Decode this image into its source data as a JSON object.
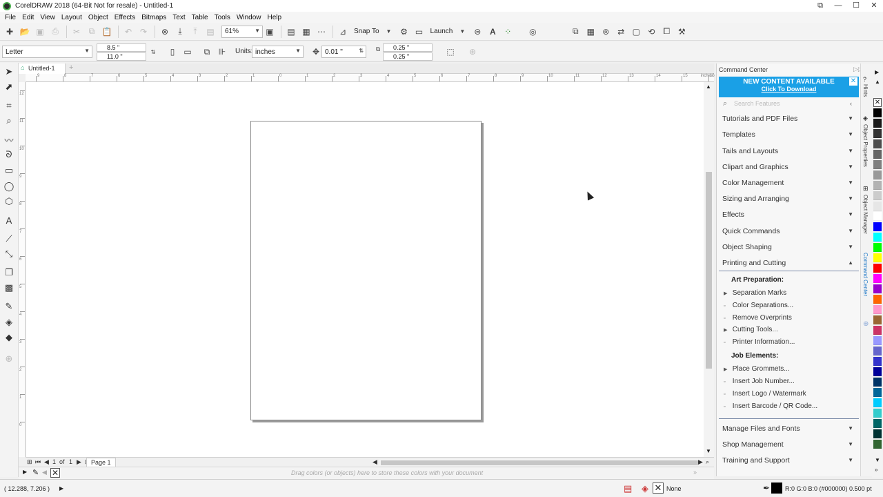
{
  "window": {
    "title": "CorelDRAW 2018 (64-Bit Not for resale) - Untitled-1",
    "controls": [
      "⧉",
      "—",
      "☐",
      "✕"
    ]
  },
  "menu": [
    "File",
    "Edit",
    "View",
    "Layout",
    "Object",
    "Effects",
    "Bitmaps",
    "Text",
    "Table",
    "Tools",
    "Window",
    "Help"
  ],
  "standard_toolbar": {
    "zoom": "61%",
    "snap_to": "Snap To",
    "launch": "Launch"
  },
  "property_bar": {
    "page_size": "Letter",
    "width": "8.5 \"",
    "height": "11.0 \"",
    "units_label": "Units:",
    "units": "inches",
    "nudge": "0.01 \"",
    "dup_x": "0.25 \"",
    "dup_y": "0.25 \""
  },
  "document": {
    "tab": "Untitled-1",
    "ruler_unit": "inches",
    "ruler_numbers": [
      "9",
      "8",
      "7",
      "6",
      "5",
      "4",
      "3",
      "2",
      "1",
      "0",
      "1",
      "2",
      "3",
      "4",
      "5",
      "6",
      "7",
      "8",
      "9",
      "10",
      "11",
      "12",
      "13",
      "14",
      "15",
      "16",
      "17"
    ],
    "v_ruler_numbers": [
      "12",
      "11",
      "10",
      "9",
      "8",
      "7",
      "6",
      "5",
      "4",
      "3",
      "2",
      "1",
      "0"
    ],
    "page_nav": {
      "current": "1",
      "of": "of",
      "total": "1",
      "page_tab": "Page 1"
    },
    "palette_hint": "Drag colors (or objects) here to store these colors with your document"
  },
  "status": {
    "coords": "( 12.288, 7.206 )",
    "fill": "None",
    "outline": "R:0 G:0 B:0 (#000000)  0.500 pt"
  },
  "command_center": {
    "title": "Command Center",
    "banner_title": "NEW CONTENT AVAILABLE",
    "banner_link": "Click To Download",
    "search_placeholder": "Search Features",
    "sections": [
      "Tutorials and PDF Files",
      "Templates",
      "Tails and Layouts",
      "Clipart and Graphics",
      "Color Management",
      "Sizing and Arranging",
      "Effects",
      "Quick Commands",
      "Object Shaping",
      "Printing and Cutting"
    ],
    "art_preparation_heading": "Art Preparation:",
    "art_preparation": [
      "Separation Marks",
      "Color Separations...",
      "Remove Overprints",
      "Cutting Tools...",
      "Printer Information..."
    ],
    "job_elements_heading": "Job Elements:",
    "job_elements": [
      "Place Grommets...",
      "Insert Job Number...",
      "Insert Logo / Watermark",
      "Insert Barcode / QR Code..."
    ],
    "bottom_sections": [
      "Manage Files and Fonts",
      "Shop Management",
      "Training and Support"
    ]
  },
  "docker_tabs": [
    "Hints",
    "Object Properties",
    "Object Manager",
    "Command Center"
  ],
  "palette_colors": [
    "#000000",
    "#1a1a1a",
    "#333333",
    "#4d4d4d",
    "#666666",
    "#808080",
    "#999999",
    "#b3b3b3",
    "#cccccc",
    "#e6e6e6",
    "#ffffff",
    "#0000ff",
    "#00ffff",
    "#00ff00",
    "#ffff00",
    "#ff0000",
    "#ff00ff",
    "#9900cc",
    "#ff6600",
    "#ff99cc",
    "#996633",
    "#cc3366",
    "#9999ff",
    "#6666cc",
    "#3333cc",
    "#000099",
    "#003366",
    "#006699",
    "#00ccff",
    "#33cccc",
    "#006666",
    "#003333",
    "#336633"
  ]
}
